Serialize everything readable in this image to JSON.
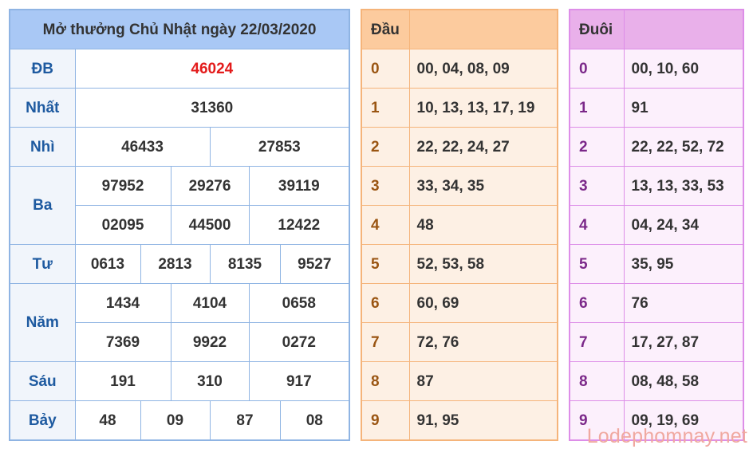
{
  "results": {
    "title": "Mở thưởng Chủ Nhật ngày 22/03/2020",
    "prizes": {
      "db": {
        "label": "ĐB",
        "values": [
          "46024"
        ]
      },
      "nhat": {
        "label": "Nhất",
        "values": [
          "31360"
        ]
      },
      "nhi": {
        "label": "Nhì",
        "values": [
          "46433",
          "27853"
        ]
      },
      "ba": {
        "label": "Ba",
        "values": [
          "97952",
          "29276",
          "39119",
          "02095",
          "44500",
          "12422"
        ]
      },
      "tu": {
        "label": "Tư",
        "values": [
          "0613",
          "2813",
          "8135",
          "9527"
        ]
      },
      "nam": {
        "label": "Năm",
        "values": [
          "1434",
          "4104",
          "0658",
          "7369",
          "9922",
          "0272"
        ]
      },
      "sau": {
        "label": "Sáu",
        "values": [
          "191",
          "310",
          "917"
        ]
      },
      "bay": {
        "label": "Bảy",
        "values": [
          "48",
          "09",
          "87",
          "08"
        ]
      }
    },
    "special_color": "#e31b1b"
  },
  "head": {
    "title": "Đầu",
    "rows": [
      {
        "k": "0",
        "v": "00, 04, 08, 09"
      },
      {
        "k": "1",
        "v": "10, 13, 13, 17, 19"
      },
      {
        "k": "2",
        "v": "22, 22, 24, 27"
      },
      {
        "k": "3",
        "v": "33, 34, 35"
      },
      {
        "k": "4",
        "v": "48"
      },
      {
        "k": "5",
        "v": "52, 53, 58"
      },
      {
        "k": "6",
        "v": "60, 69"
      },
      {
        "k": "7",
        "v": "72, 76"
      },
      {
        "k": "8",
        "v": "87"
      },
      {
        "k": "9",
        "v": "91, 95"
      }
    ]
  },
  "tail": {
    "title": "Đuôi",
    "rows": [
      {
        "k": "0",
        "v": "00, 10, 60"
      },
      {
        "k": "1",
        "v": "91"
      },
      {
        "k": "2",
        "v": "22, 22, 52, 72"
      },
      {
        "k": "3",
        "v": "13, 13, 33, 53"
      },
      {
        "k": "4",
        "v": "04, 24, 34"
      },
      {
        "k": "5",
        "v": "35, 95"
      },
      {
        "k": "6",
        "v": "76"
      },
      {
        "k": "7",
        "v": "17, 27, 87"
      },
      {
        "k": "8",
        "v": "08, 48, 58"
      },
      {
        "k": "9",
        "v": "09, 19, 69"
      }
    ]
  },
  "watermark": "Lodephomnay.net"
}
